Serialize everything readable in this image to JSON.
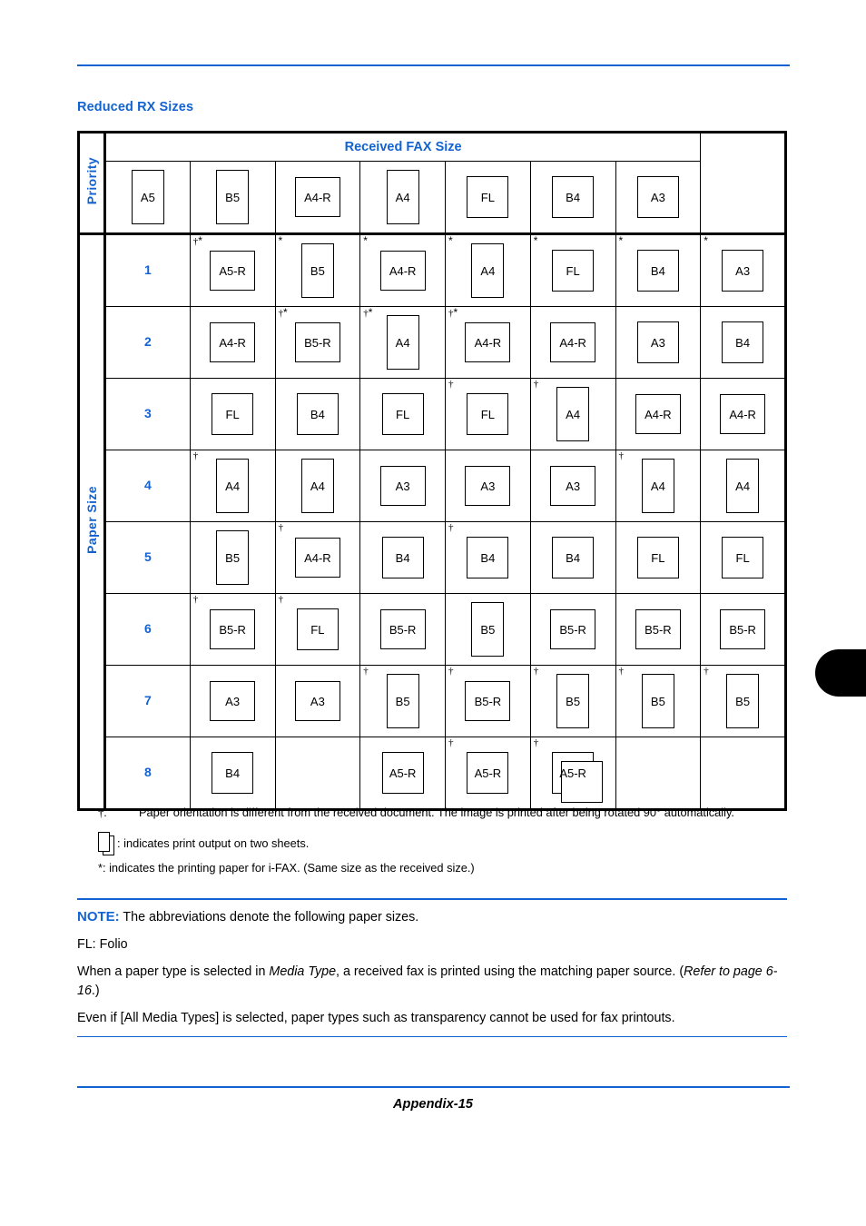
{
  "document": {
    "section_heading": "Reduced RX Sizes",
    "footer": "Appendix-15"
  },
  "table": {
    "priority_label": "Priority",
    "paper_size_label": "Paper Size",
    "received_fax_size_label": "Received FAX Size",
    "columns": [
      "A5",
      "B5",
      "A4-R",
      "A4",
      "FL",
      "B4",
      "A3"
    ],
    "column_shapes": [
      "tall",
      "tall",
      "wide",
      "tall",
      "square",
      "square",
      "square"
    ],
    "rows": [
      {
        "priority": "1",
        "cells": [
          {
            "label": "A5-R",
            "shape": "wide",
            "marks": "dagger-star",
            "sheets": 1
          },
          {
            "label": "B5",
            "shape": "tall",
            "marks": "star",
            "sheets": 1
          },
          {
            "label": "A4-R",
            "shape": "wide",
            "marks": "star",
            "sheets": 1
          },
          {
            "label": "A4",
            "shape": "tall",
            "marks": "star",
            "sheets": 1
          },
          {
            "label": "FL",
            "shape": "square",
            "marks": "star",
            "sheets": 1
          },
          {
            "label": "B4",
            "shape": "square",
            "marks": "star",
            "sheets": 1
          },
          {
            "label": "A3",
            "shape": "square",
            "marks": "star",
            "sheets": 1
          }
        ]
      },
      {
        "priority": "2",
        "cells": [
          {
            "label": "A4-R",
            "shape": "wide",
            "marks": "",
            "sheets": 1
          },
          {
            "label": "B5-R",
            "shape": "wide",
            "marks": "dagger-star",
            "sheets": 1
          },
          {
            "label": "A4",
            "shape": "tall",
            "marks": "dagger-star",
            "sheets": 1
          },
          {
            "label": "A4-R",
            "shape": "wide",
            "marks": "dagger-star",
            "sheets": 1
          },
          {
            "label": "A4-R",
            "shape": "wide",
            "marks": "",
            "sheets": 1
          },
          {
            "label": "A3",
            "shape": "square",
            "marks": "",
            "sheets": 1
          },
          {
            "label": "B4",
            "shape": "square",
            "marks": "",
            "sheets": 1
          }
        ]
      },
      {
        "priority": "3",
        "cells": [
          {
            "label": "FL",
            "shape": "square",
            "marks": "",
            "sheets": 1
          },
          {
            "label": "B4",
            "shape": "square",
            "marks": "",
            "sheets": 1
          },
          {
            "label": "FL",
            "shape": "square",
            "marks": "",
            "sheets": 1
          },
          {
            "label": "FL",
            "shape": "square",
            "marks": "dagger",
            "sheets": 1
          },
          {
            "label": "A4",
            "shape": "tall",
            "marks": "dagger",
            "sheets": 1
          },
          {
            "label": "A4-R",
            "shape": "wide",
            "marks": "",
            "sheets": 1
          },
          {
            "label": "A4-R",
            "shape": "wide",
            "marks": "",
            "sheets": 1
          }
        ]
      },
      {
        "priority": "4",
        "cells": [
          {
            "label": "A4",
            "shape": "tall",
            "marks": "dagger",
            "sheets": 1
          },
          {
            "label": "A4",
            "shape": "tall",
            "marks": "",
            "sheets": 1
          },
          {
            "label": "A3",
            "shape": "wide",
            "marks": "",
            "sheets": 1
          },
          {
            "label": "A3",
            "shape": "wide",
            "marks": "",
            "sheets": 1
          },
          {
            "label": "A3",
            "shape": "wide",
            "marks": "",
            "sheets": 1
          },
          {
            "label": "A4",
            "shape": "tall",
            "marks": "dagger",
            "sheets": 1
          },
          {
            "label": "A4",
            "shape": "tall",
            "marks": "",
            "sheets": 1
          }
        ]
      },
      {
        "priority": "5",
        "cells": [
          {
            "label": "B5",
            "shape": "tall",
            "marks": "",
            "sheets": 1
          },
          {
            "label": "A4-R",
            "shape": "wide",
            "marks": "dagger",
            "sheets": 1
          },
          {
            "label": "B4",
            "shape": "square",
            "marks": "",
            "sheets": 1
          },
          {
            "label": "B4",
            "shape": "square",
            "marks": "dagger",
            "sheets": 1
          },
          {
            "label": "B4",
            "shape": "square",
            "marks": "",
            "sheets": 1
          },
          {
            "label": "FL",
            "shape": "square",
            "marks": "",
            "sheets": 1
          },
          {
            "label": "FL",
            "shape": "square",
            "marks": "",
            "sheets": 1
          }
        ]
      },
      {
        "priority": "6",
        "cells": [
          {
            "label": "B5-R",
            "shape": "wide",
            "marks": "dagger",
            "sheets": 1
          },
          {
            "label": "FL",
            "shape": "square",
            "marks": "dagger",
            "sheets": 1
          },
          {
            "label": "B5-R",
            "shape": "wide",
            "marks": "",
            "sheets": 1
          },
          {
            "label": "B5",
            "shape": "tall",
            "marks": "",
            "sheets": 1
          },
          {
            "label": "B5-R",
            "shape": "wide",
            "marks": "",
            "sheets": 1
          },
          {
            "label": "B5-R",
            "shape": "wide",
            "marks": "",
            "sheets": 1
          },
          {
            "label": "B5-R",
            "shape": "wide",
            "marks": "",
            "sheets": 1
          }
        ]
      },
      {
        "priority": "7",
        "cells": [
          {
            "label": "A3",
            "shape": "wide",
            "marks": "",
            "sheets": 1
          },
          {
            "label": "A3",
            "shape": "wide",
            "marks": "",
            "sheets": 1
          },
          {
            "label": "B5",
            "shape": "tall",
            "marks": "dagger",
            "sheets": 1
          },
          {
            "label": "B5-R",
            "shape": "wide",
            "marks": "dagger",
            "sheets": 1
          },
          {
            "label": "B5",
            "shape": "tall",
            "marks": "dagger",
            "sheets": 1
          },
          {
            "label": "B5",
            "shape": "tall",
            "marks": "dagger",
            "sheets": 1
          },
          {
            "label": "B5",
            "shape": "tall",
            "marks": "dagger",
            "sheets": 1
          }
        ]
      },
      {
        "priority": "8",
        "cells": [
          {
            "label": "B4",
            "shape": "square",
            "marks": "",
            "sheets": 1
          },
          {
            "label": "",
            "shape": "none",
            "marks": "",
            "sheets": 0
          },
          {
            "label": "A5-R",
            "shape": "square",
            "marks": "",
            "sheets": 1
          },
          {
            "label": "A5-R",
            "shape": "square",
            "marks": "dagger",
            "sheets": 1
          },
          {
            "label": "A5-R",
            "shape": "square",
            "marks": "dagger",
            "sheets": 2
          },
          {
            "label": "",
            "shape": "none",
            "marks": "",
            "sheets": 0
          },
          {
            "label": "",
            "shape": "none",
            "marks": "",
            "sheets": 0
          }
        ]
      }
    ]
  },
  "footnotes": {
    "dagger_mark": "†.",
    "dagger_text": "Paper orientation is different from the received document. The image is printed after being rotated 90° automatically.",
    "two_sheets_text": ": indicates print output on two sheets.",
    "star_text": "*: indicates the printing paper for i-FAX. (Same size as the received size.)"
  },
  "note": {
    "label": "NOTE:",
    "line1": "The abbreviations denote the following paper sizes.",
    "line2": "FL: Folio",
    "line3_a": "When a paper type is selected in ",
    "line3_em1": "Media Type",
    "line3_b": ", a received fax is printed using the matching paper source. (",
    "line3_em2": "Refer to page 6-16",
    "line3_c": ".)",
    "line4": "Even if [All Media Types] is selected, paper types such as transparency cannot be used for fax printouts."
  },
  "colors": {
    "accent_blue": "#1263d2",
    "text_black": "#000000"
  }
}
